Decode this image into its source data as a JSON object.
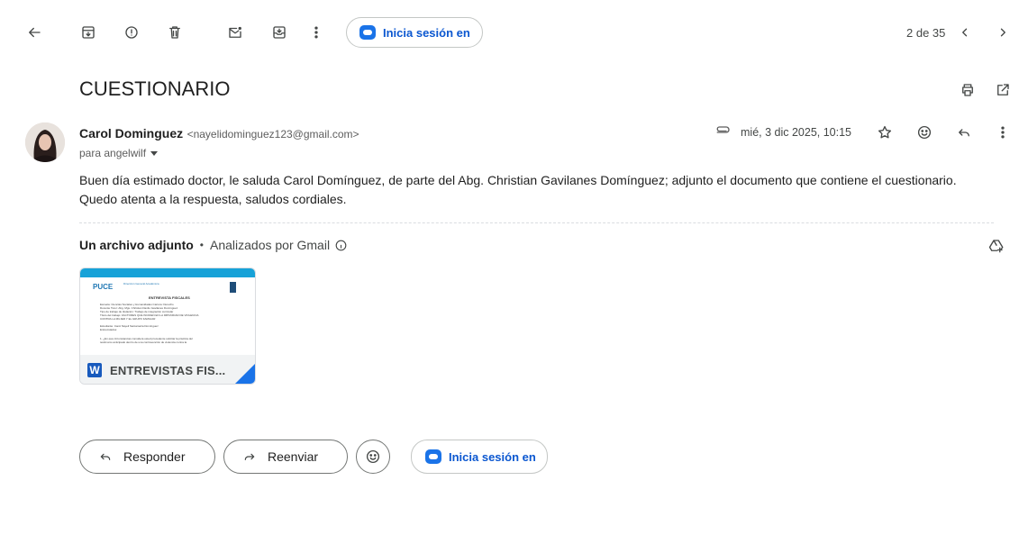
{
  "toolbar": {
    "extension_label": "Inicia sesión en",
    "pagination": "2 de 35"
  },
  "email": {
    "subject": "CUESTIONARIO",
    "sender_name": "Carol Dominguez",
    "sender_email": "<nayelidominguez123@gmail.com>",
    "recipient": "para angelwilf",
    "date": "mié, 3 dic 2025, 10:15",
    "body_line1": "Buen día estimado doctor, le saluda Carol Domínguez, de parte del Abg. Christian Gavilanes Domínguez; adjunto el documento que contiene el cuestionario.",
    "body_line2": "Quedo atenta a la respuesta, saludos cordiales."
  },
  "attachments": {
    "count_label": "Un archivo adjunto",
    "separator": "•",
    "scan_label": "Analizados por Gmail",
    "file": {
      "name": "ENTREVISTAS FIS...",
      "type_badge": "W",
      "preview": {
        "logo": "PUCE",
        "header_small": "Dirección General Académica",
        "title": "ENTREVISTA FISCALES",
        "lines": [
          "Escuela: Ciencias Sociales y Humanidades   Carrera: Derecho",
          "Docente Tutor: Abg. Mgs. Christian Danilo Gavilanes Domínguez",
          "Tipo de trabajo de titulación: Trabajo de integración curricular",
          "Título del trabajo: FACTORES QUE INCIDEN EN LA IMPUNIDAD DE VIOLENCIA",
          "CONTRA LA MUJER Y EL GRUPO FAMILIAR",
          "Estudiante: Carol Nayeli Santamaría Domínguez",
          "Entrevistados:",
          "1. ¿En qué circunstancias considera usted procedente solicitar la práctica del",
          "testimonio anticipado dentro de una contravención de violencia contra la"
        ]
      }
    }
  },
  "actions": {
    "reply": "Responder",
    "forward": "Reenviar",
    "extension_label": "Inicia sesión en"
  },
  "colors": {
    "accent": "#1a73e8",
    "link": "#0b57d0",
    "preview_bar": "#17a2d8",
    "word_blue": "#185abd"
  }
}
